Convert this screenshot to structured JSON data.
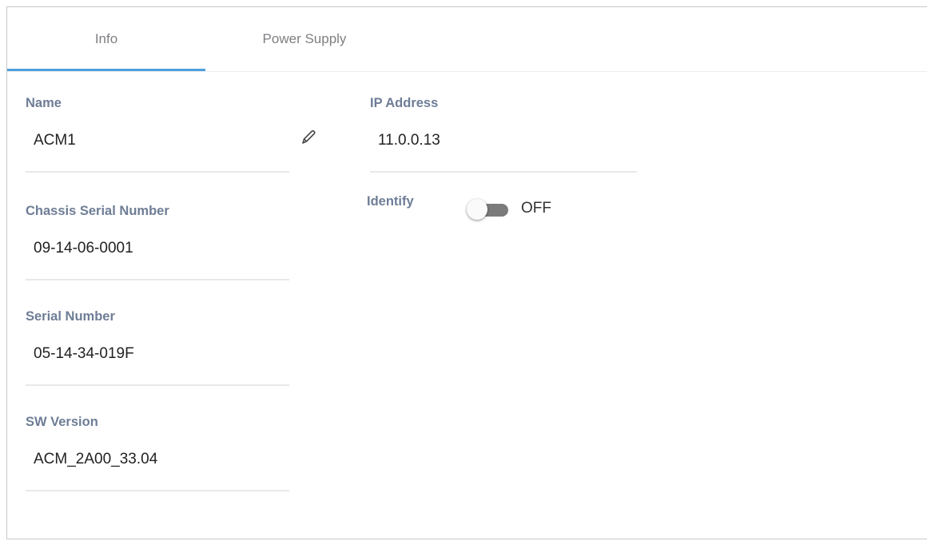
{
  "tabs": [
    {
      "label": "Info",
      "active": true
    },
    {
      "label": "Power Supply",
      "active": false
    }
  ],
  "accent_color": "#4f9fdb",
  "fields": {
    "name": {
      "label": "Name",
      "value": "ACM1"
    },
    "chassis_serial": {
      "label": "Chassis Serial Number",
      "value": "09-14-06-0001"
    },
    "serial": {
      "label": "Serial Number",
      "value": "05-14-34-019F"
    },
    "sw_version": {
      "label": "SW Version",
      "value": "ACM_2A00_33.04"
    },
    "ip_address": {
      "label": "IP Address",
      "value": "11.0.0.13"
    }
  },
  "identify": {
    "label": "Identify",
    "state": "OFF",
    "enabled": false
  },
  "icons": {
    "edit": "pencil-icon"
  }
}
